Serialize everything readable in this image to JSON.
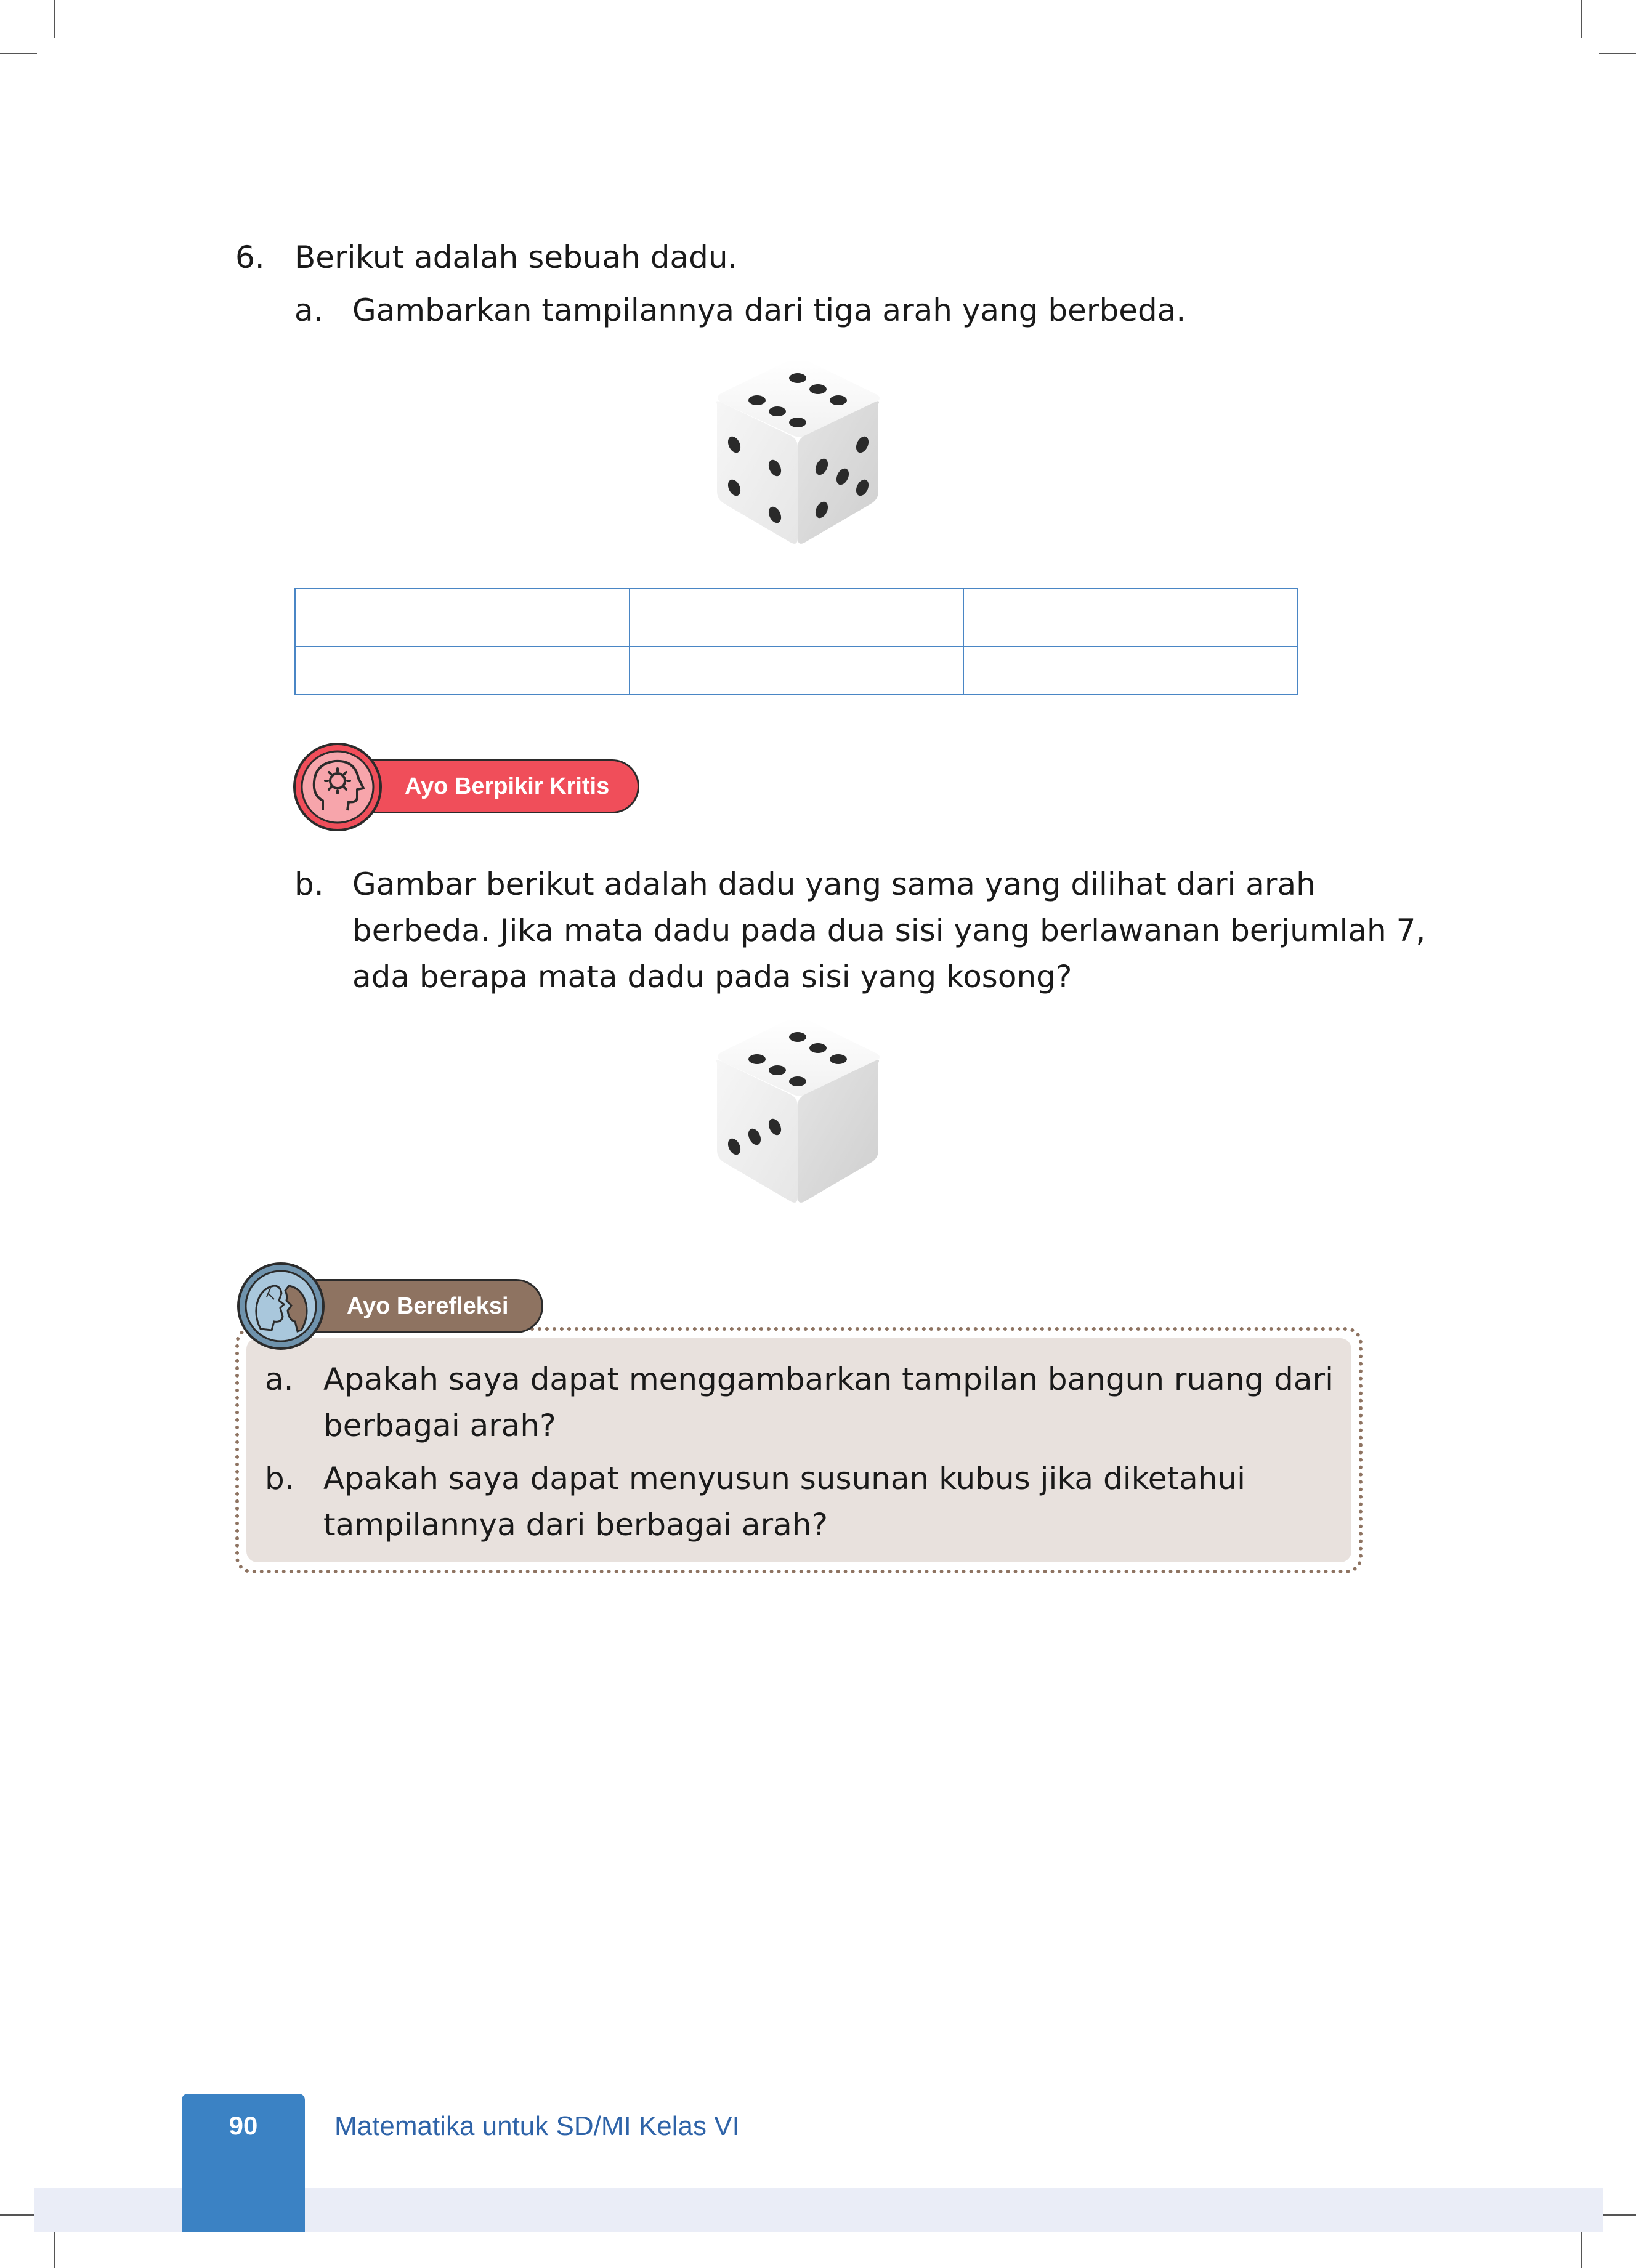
{
  "question": {
    "number": "6.",
    "text": "Berikut adalah sebuah dadu.",
    "part_a": {
      "label": "a.",
      "text": "Gambarkan tampilannya dari tiga arah yang berbeda."
    },
    "part_b": {
      "label": "b.",
      "lines": [
        "Gambar berikut adalah dadu yang sama yang dilihat dari arah",
        "berbeda. Jika mata dadu pada dua sisi yang berlawanan berjumlah 7,",
        "ada berapa mata dadu pada sisi yang kosong?"
      ]
    }
  },
  "answer_table": {
    "rows": [
      [
        "",
        "",
        ""
      ],
      [
        "",
        "",
        ""
      ]
    ],
    "border_color": "#4a86c5"
  },
  "critical_badge": {
    "label": "Ayo Berpikir Kritis",
    "icon": "head-gear-icon",
    "color": "#f04e5a"
  },
  "reflection": {
    "badge_label": "Ayo Berefleksi",
    "icon": "two-faces-icon",
    "badge_color": "#8e7361",
    "box_color": "#e8e1dd",
    "items": [
      {
        "label": "a.",
        "lines": [
          "Apakah saya dapat menggambarkan tampilan bangun ruang dari",
          "berbagai arah?"
        ]
      },
      {
        "label": "b.",
        "lines": [
          "Apakah saya dapat menyusun susunan kubus jika diketahui",
          "tampilannya dari berbagai arah?"
        ]
      }
    ]
  },
  "footer": {
    "page_number": "90",
    "book_title": "Matematika untuk SD/MI Kelas VI",
    "accent": "#3b82c4"
  }
}
